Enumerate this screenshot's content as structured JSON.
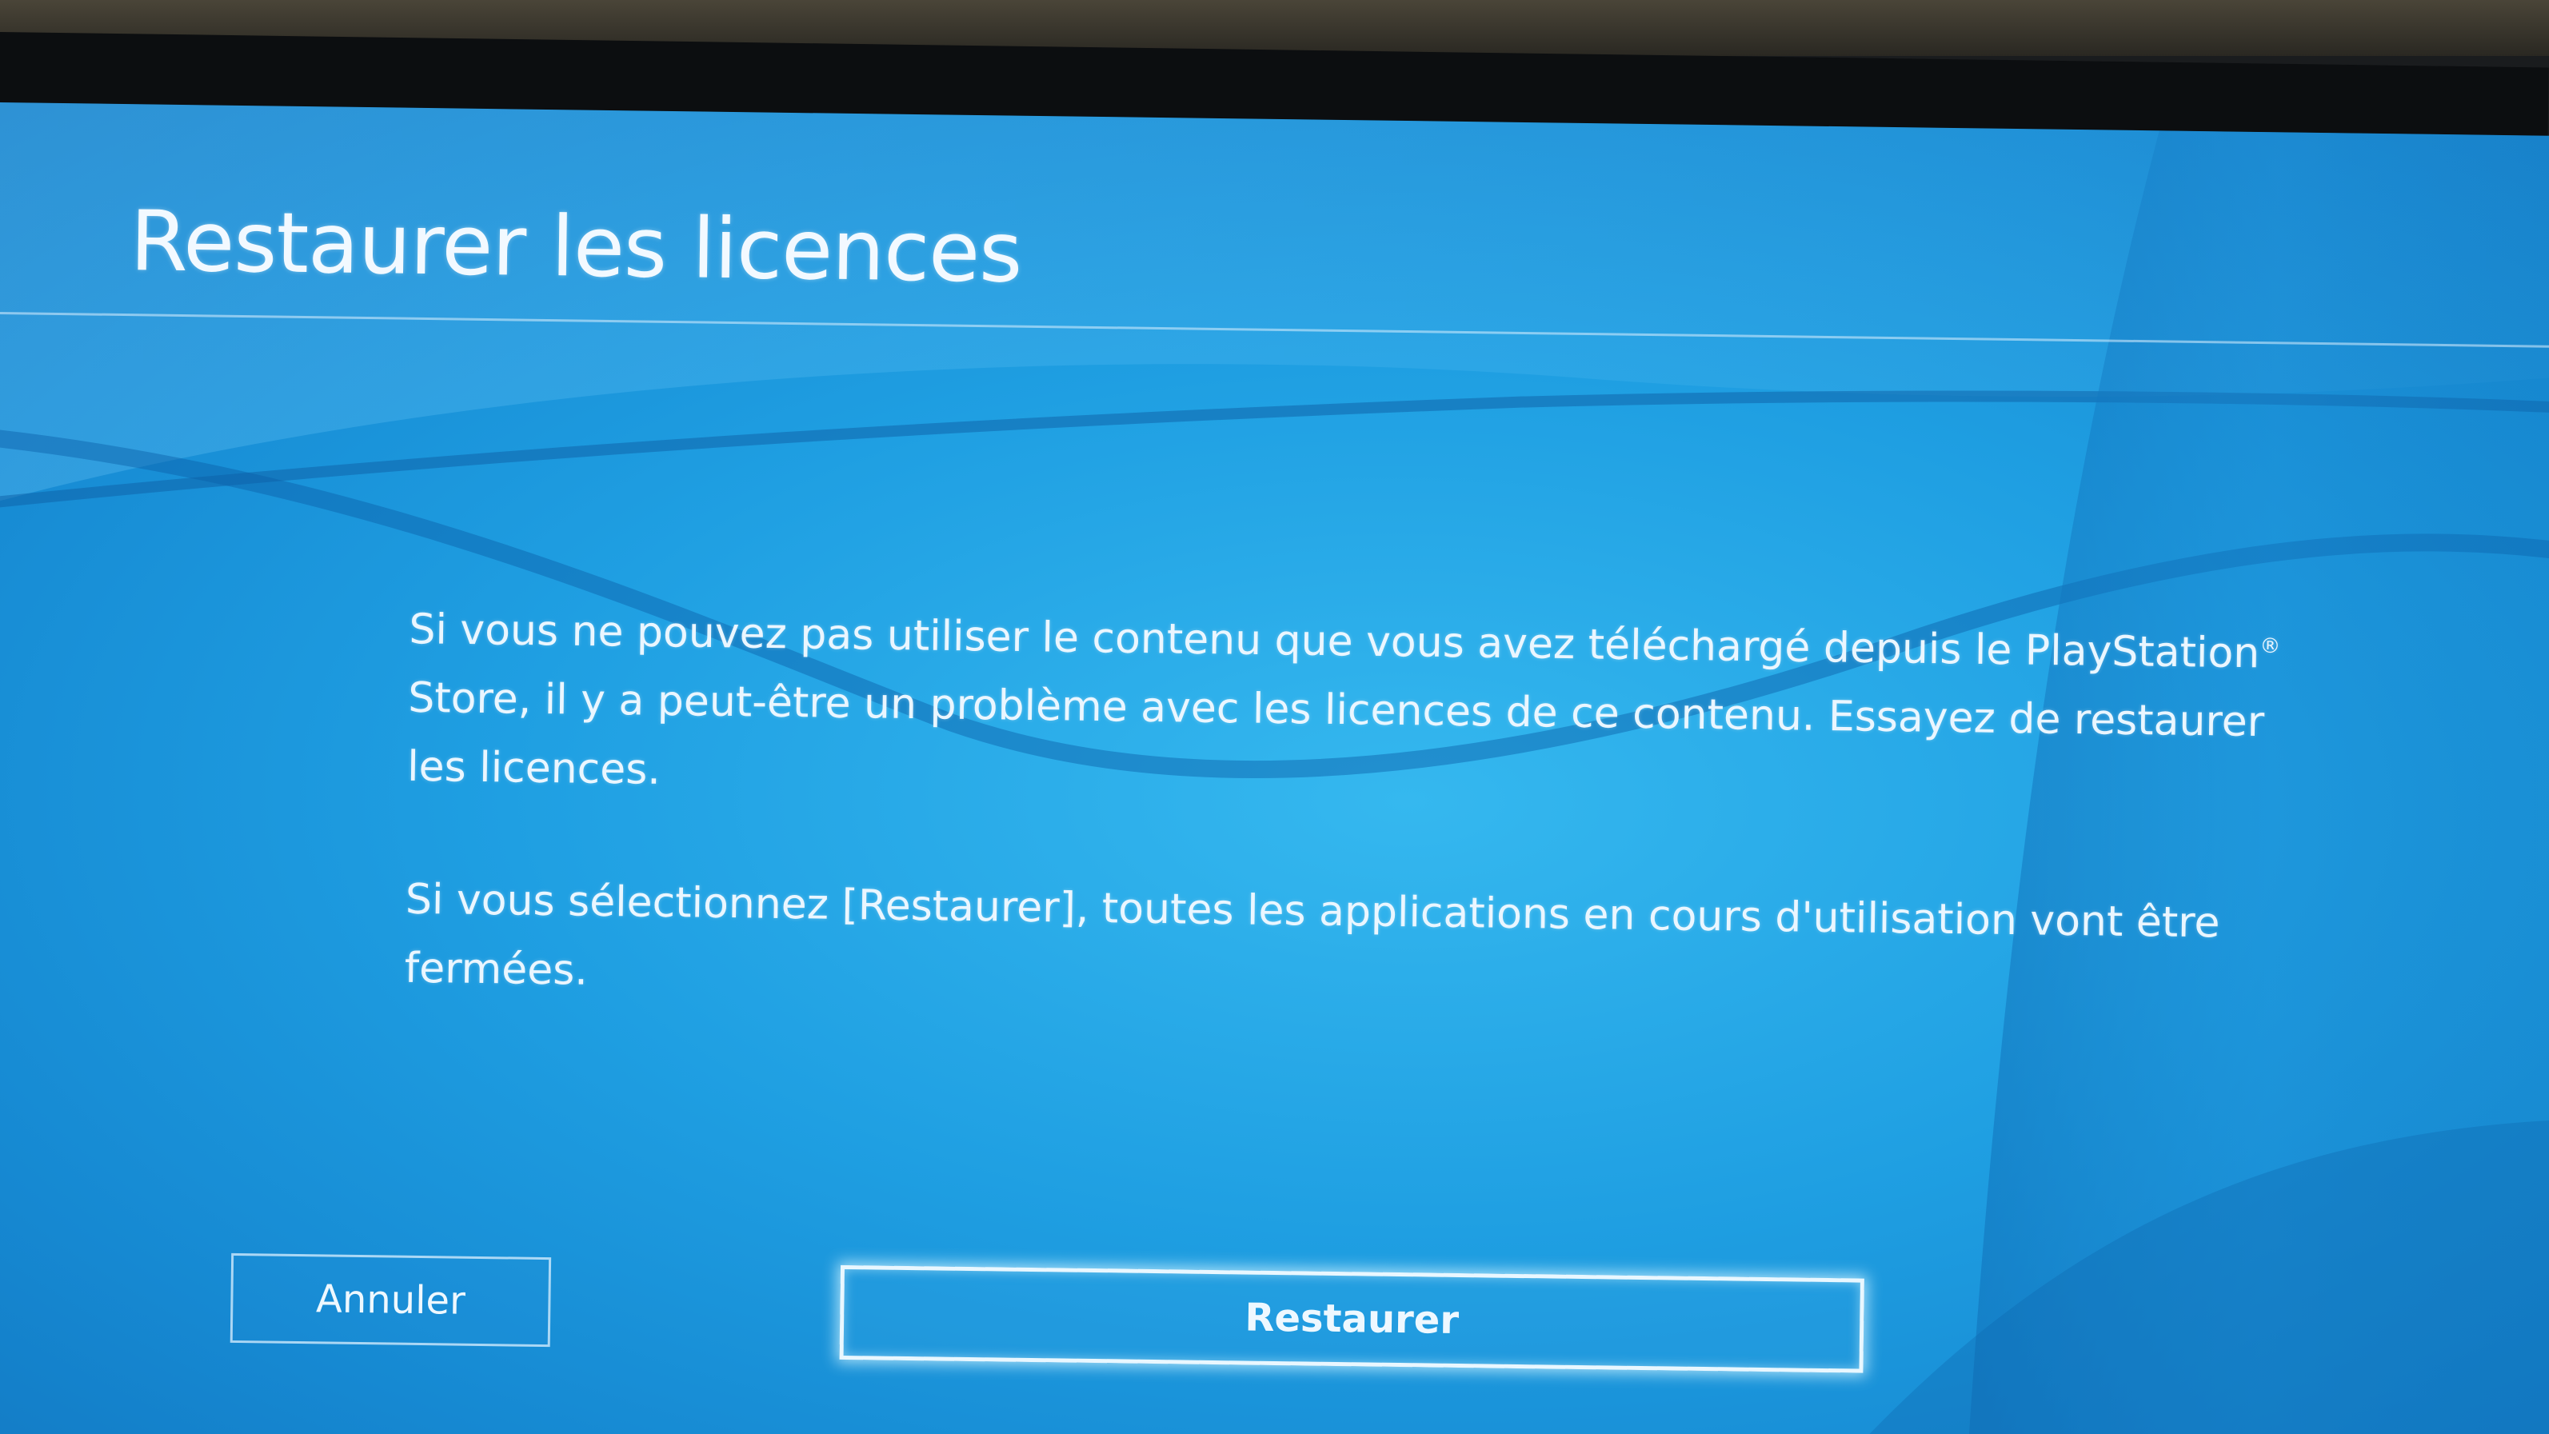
{
  "dialog": {
    "title": "Restaurer les licences",
    "paragraph_1_before": "Si vous ne pouvez pas utiliser le contenu que vous avez téléchargé depuis le PlayStation",
    "registered_mark": "®",
    "paragraph_1_after": " Store, il y a peut-être un problème avec les licences de ce contenu. Essayez de restaurer les licences.",
    "paragraph_2": "Si vous sélectionnez [Restaurer], toutes les applications en cours d'utilisation vont être fermées."
  },
  "buttons": {
    "cancel_label": "Annuler",
    "restore_label": "Restaurer",
    "focused": "restore"
  },
  "colors": {
    "background_blue": "#1f9fe2",
    "text": "#eaf6ff",
    "focus_glow": "#e9f7ff"
  }
}
